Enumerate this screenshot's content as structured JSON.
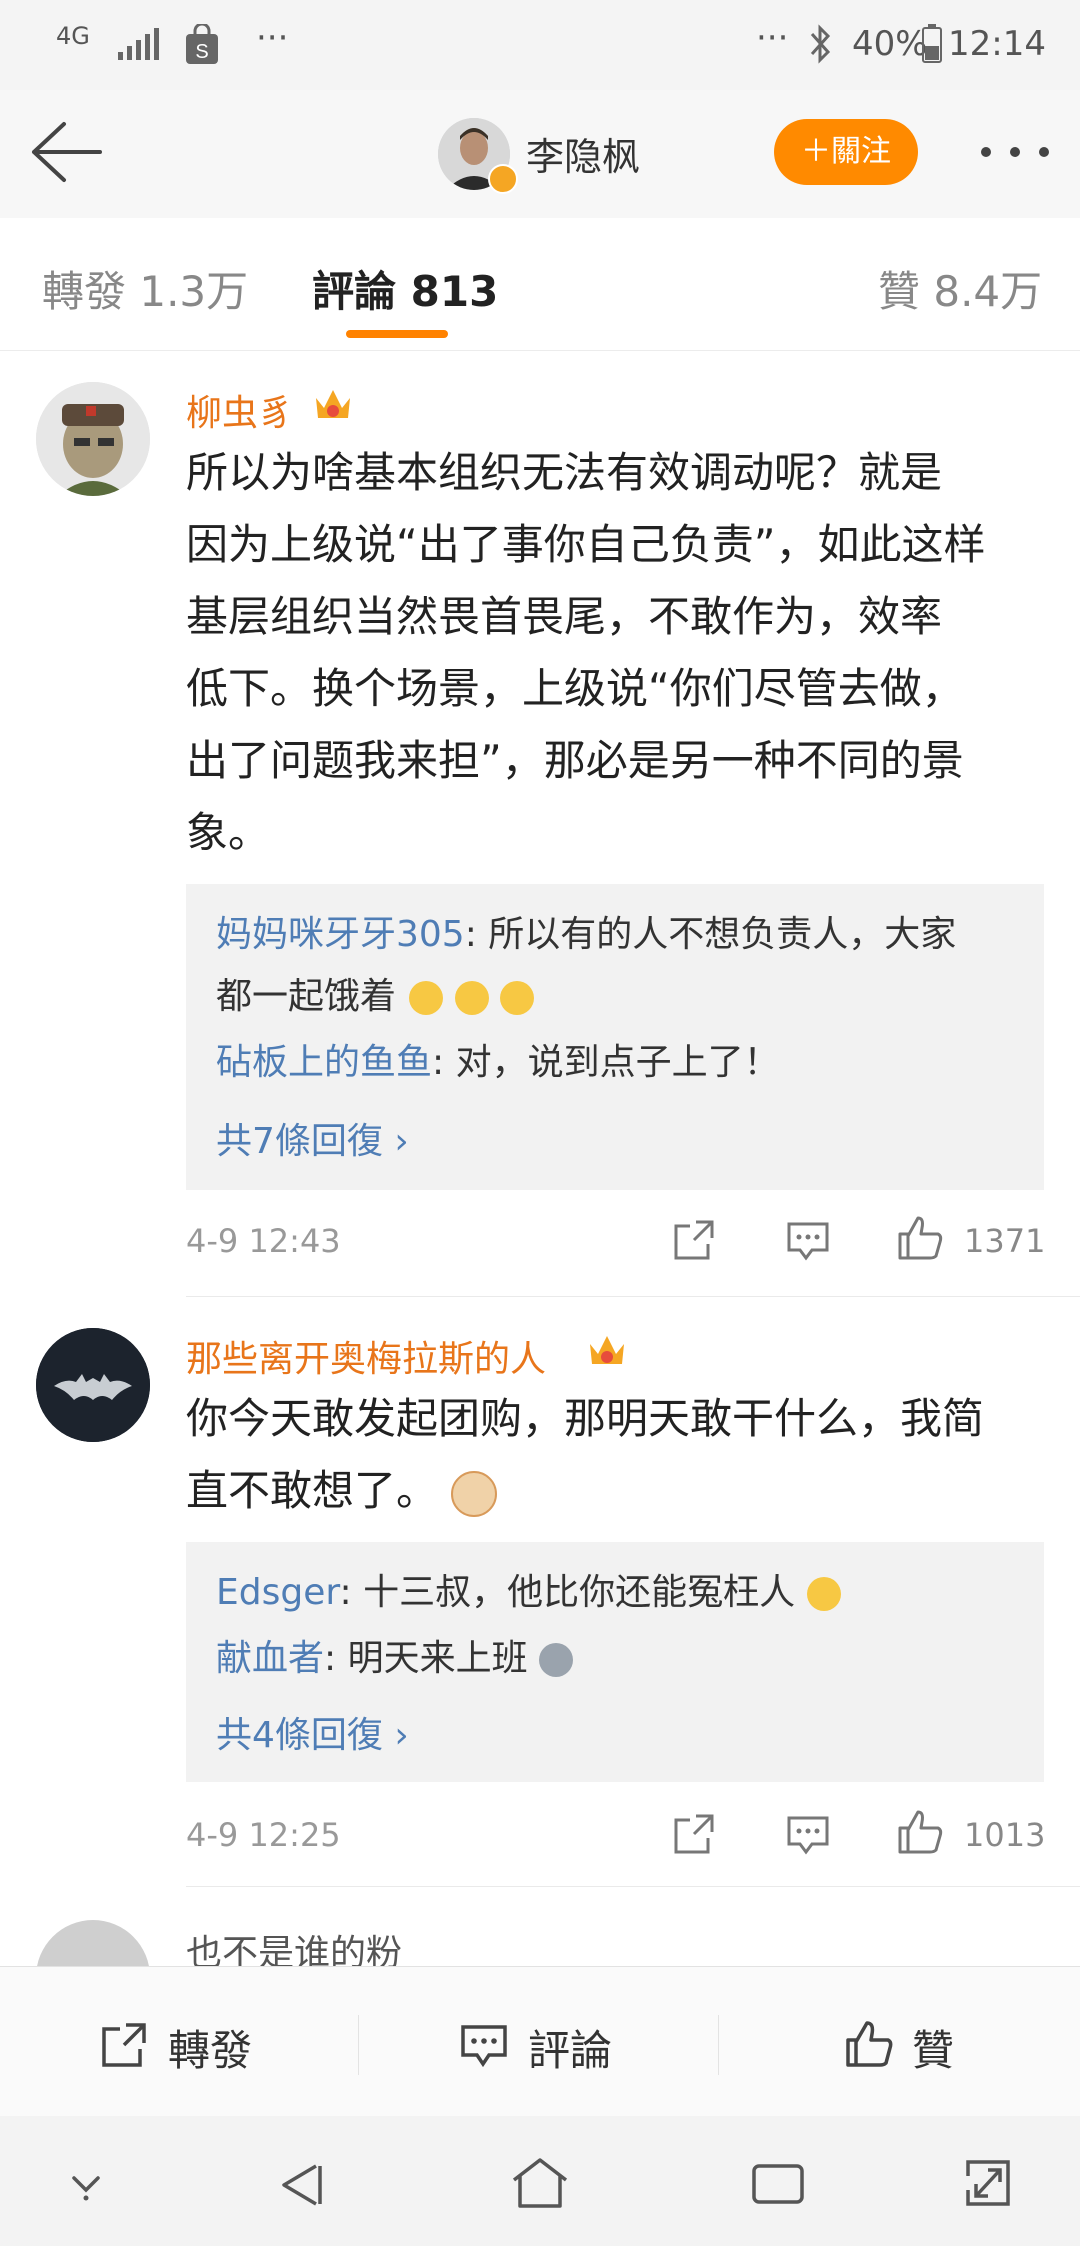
{
  "status_bar": {
    "network": "4G",
    "battery": "40%",
    "time": "12:14"
  },
  "header": {
    "title": "李隐枫",
    "follow_label": "＋關注"
  },
  "tabs": [
    {
      "label": "轉發 1.3万"
    },
    {
      "label": "評論 813"
    },
    {
      "label": "贊 8.4万"
    }
  ],
  "comments": [
    {
      "username": "柳虫豸",
      "text_lines": [
        "所以为啥基本组织无法有效调动呢？就是",
        "因为上级说“出了事你自己负责”，如此这样",
        "基层组织当然畏首畏尾，不敢作为，效率",
        "低下。换个场景，上级说“你们尽管去做，",
        "出了问题我来担”，那必是另一种不同的景",
        "象。"
      ],
      "replies": [
        {
          "user": "妈妈咪牙牙305",
          "text_1": ": 所以有的人不想负责人，大家",
          "text_2": "都一起饿着"
        },
        {
          "user": "砧板上的鱼鱼",
          "text_1": ": 对，说到点子上了！"
        }
      ],
      "more_replies": "共7條回復 ›",
      "time": "4-9 12:43",
      "likes": "1371"
    },
    {
      "username": "那些离开奥梅拉斯的人",
      "text_lines": [
        "你今天敢发起团购，那明天敢干什么，我简",
        "直不敢想了。"
      ],
      "replies": [
        {
          "user": "Edsger",
          "text_1": ": 十三叔，他比你还能冤枉人"
        },
        {
          "user": "献血者",
          "text_1": ": 明天来上班"
        }
      ],
      "more_replies": "共4條回復 ›",
      "time": "4-9 12:25",
      "likes": "1013"
    },
    {
      "username": "也不是谁的粉"
    }
  ],
  "bottom_bar": {
    "repost": "轉發",
    "comment": "評論",
    "like": "贊"
  },
  "colors": {
    "accent": "#ff8200",
    "username": "#e8751a",
    "link": "#4f7db5"
  }
}
